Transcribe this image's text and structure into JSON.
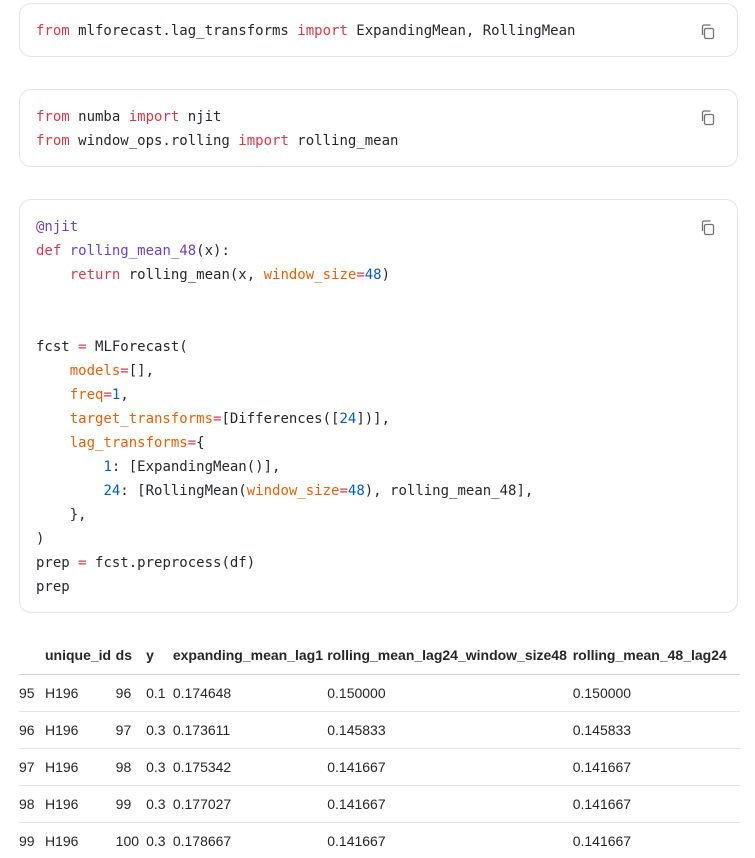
{
  "code_blocks": [
    {
      "lines": [
        [
          [
            "kw",
            "from"
          ],
          [
            "t",
            " mlforecast.lag_transforms "
          ],
          [
            "kw",
            "import"
          ],
          [
            "t",
            " ExpandingMean, RollingMean"
          ]
        ]
      ]
    },
    {
      "lines": [
        [
          [
            "kw",
            "from"
          ],
          [
            "t",
            " numba "
          ],
          [
            "kw",
            "import"
          ],
          [
            "t",
            " njit"
          ]
        ],
        [
          [
            "kw",
            "from"
          ],
          [
            "t",
            " window_ops.rolling "
          ],
          [
            "kw",
            "import"
          ],
          [
            "t",
            " rolling_mean"
          ]
        ]
      ]
    },
    {
      "lines": [
        [
          [
            "dec",
            "@njit"
          ]
        ],
        [
          [
            "kw",
            "def"
          ],
          [
            "t",
            " "
          ],
          [
            "fn",
            "rolling_mean_48"
          ],
          [
            "t",
            "(x):"
          ]
        ],
        [
          [
            "t",
            "    "
          ],
          [
            "kw",
            "return"
          ],
          [
            "t",
            " rolling_mean(x, "
          ],
          [
            "arg",
            "window_size"
          ],
          [
            "op",
            "="
          ],
          [
            "num",
            "48"
          ],
          [
            "t",
            ")"
          ]
        ],
        [
          [
            "t",
            ""
          ]
        ],
        [
          [
            "t",
            ""
          ]
        ],
        [
          [
            "t",
            "fcst "
          ],
          [
            "op",
            "="
          ],
          [
            "t",
            " MLForecast("
          ]
        ],
        [
          [
            "t",
            "    "
          ],
          [
            "arg",
            "models"
          ],
          [
            "op",
            "="
          ],
          [
            "t",
            "[],"
          ]
        ],
        [
          [
            "t",
            "    "
          ],
          [
            "arg",
            "freq"
          ],
          [
            "op",
            "="
          ],
          [
            "num",
            "1"
          ],
          [
            "t",
            ","
          ]
        ],
        [
          [
            "t",
            "    "
          ],
          [
            "arg",
            "target_transforms"
          ],
          [
            "op",
            "="
          ],
          [
            "t",
            "[Differences(["
          ],
          [
            "num",
            "24"
          ],
          [
            "t",
            "])],"
          ]
        ],
        [
          [
            "t",
            "    "
          ],
          [
            "arg",
            "lag_transforms"
          ],
          [
            "op",
            "="
          ],
          [
            "t",
            "{"
          ]
        ],
        [
          [
            "t",
            "        "
          ],
          [
            "num",
            "1"
          ],
          [
            "t",
            ": [ExpandingMean()],"
          ]
        ],
        [
          [
            "t",
            "        "
          ],
          [
            "num",
            "24"
          ],
          [
            "t",
            ": [RollingMean("
          ],
          [
            "arg",
            "window_size"
          ],
          [
            "op",
            "="
          ],
          [
            "num",
            "48"
          ],
          [
            "t",
            "), rolling_mean_48],"
          ]
        ],
        [
          [
            "t",
            "    },"
          ]
        ],
        [
          [
            "t",
            ")"
          ]
        ],
        [
          [
            "t",
            "prep "
          ],
          [
            "op",
            "="
          ],
          [
            "t",
            " fcst.preprocess(df)"
          ]
        ],
        [
          [
            "t",
            "prep"
          ]
        ]
      ]
    }
  ],
  "copy_icon": "copy-icon",
  "table": {
    "columns": [
      "",
      "unique_id",
      "ds",
      "y",
      "expanding_mean_lag1",
      "rolling_mean_lag24_window_size48",
      "rolling_mean_48_lag24"
    ],
    "rows": [
      [
        "95",
        "H196",
        "96",
        "0.1",
        "0.174648",
        "0.150000",
        "0.150000"
      ],
      [
        "96",
        "H196",
        "97",
        "0.3",
        "0.173611",
        "0.145833",
        "0.145833"
      ],
      [
        "97",
        "H196",
        "98",
        "0.3",
        "0.175342",
        "0.141667",
        "0.141667"
      ],
      [
        "98",
        "H196",
        "99",
        "0.3",
        "0.177027",
        "0.141667",
        "0.141667"
      ],
      [
        "99",
        "H196",
        "100",
        "0.3",
        "0.178667",
        "0.141667",
        "0.141667"
      ]
    ]
  }
}
